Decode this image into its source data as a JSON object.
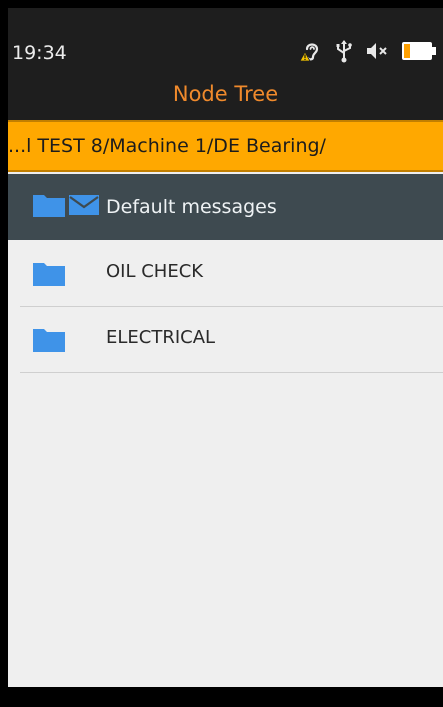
{
  "status": {
    "time": "19:34",
    "icons": [
      "hearing-warning-icon",
      "usb-icon",
      "mute-icon",
      "battery-icon"
    ]
  },
  "header": {
    "title": "Node Tree"
  },
  "path": {
    "text": "...l TEST 8/Machine 1/DE Bearing/"
  },
  "folder_header": {
    "label": "Default messages",
    "icons": [
      "folder-icon",
      "mail-icon"
    ]
  },
  "items": [
    {
      "label": "OIL CHECK",
      "icon": "folder-icon"
    },
    {
      "label": "ELECTRICAL",
      "icon": "folder-icon"
    }
  ],
  "colors": {
    "accent": "#f08a2c",
    "path_bg": "#ffa800",
    "header_row_bg": "#3e4a50",
    "folder": "#3f93e8"
  }
}
